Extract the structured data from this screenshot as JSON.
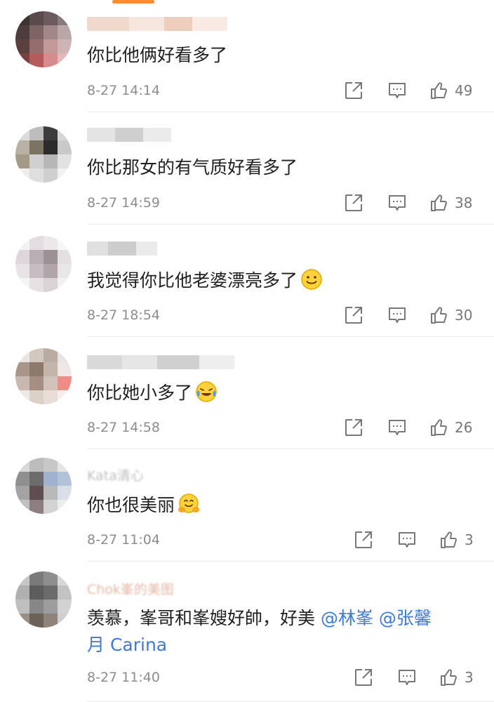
{
  "comments": [
    {
      "text": "你比他俩好看多了",
      "time": "8-27 14:14",
      "likes": "49",
      "username_text": ""
    },
    {
      "text": "你比那女的有气质好看多了",
      "time": "8-27 14:59",
      "likes": "38",
      "username_text": ""
    },
    {
      "text": "我觉得你比他老婆漂亮多了",
      "time": "8-27 18:54",
      "likes": "30",
      "username_text": ""
    },
    {
      "text": "你比她小多了",
      "time": "8-27 14:58",
      "likes": "26",
      "username_text": ""
    },
    {
      "text": "你也很美丽",
      "time": "8-27 11:04",
      "likes": "3",
      "username_text": "Kata清心"
    },
    {
      "text_part1": "羡慕，峯哥和峯嫂好帥，好美 ",
      "mention1": "@林峯",
      "mention2": "@张馨",
      "text_line2": "月 Carina",
      "time": "8-27 11:40",
      "likes": "3",
      "username_text": "Chok峯的美图"
    }
  ],
  "icons": {
    "share": "share-icon",
    "comment": "comment-icon",
    "like": "thumbs-up-icon"
  },
  "colors": {
    "accent": "#ff8a32",
    "mention": "#3e7ad6",
    "meta": "#8d8d8d"
  }
}
